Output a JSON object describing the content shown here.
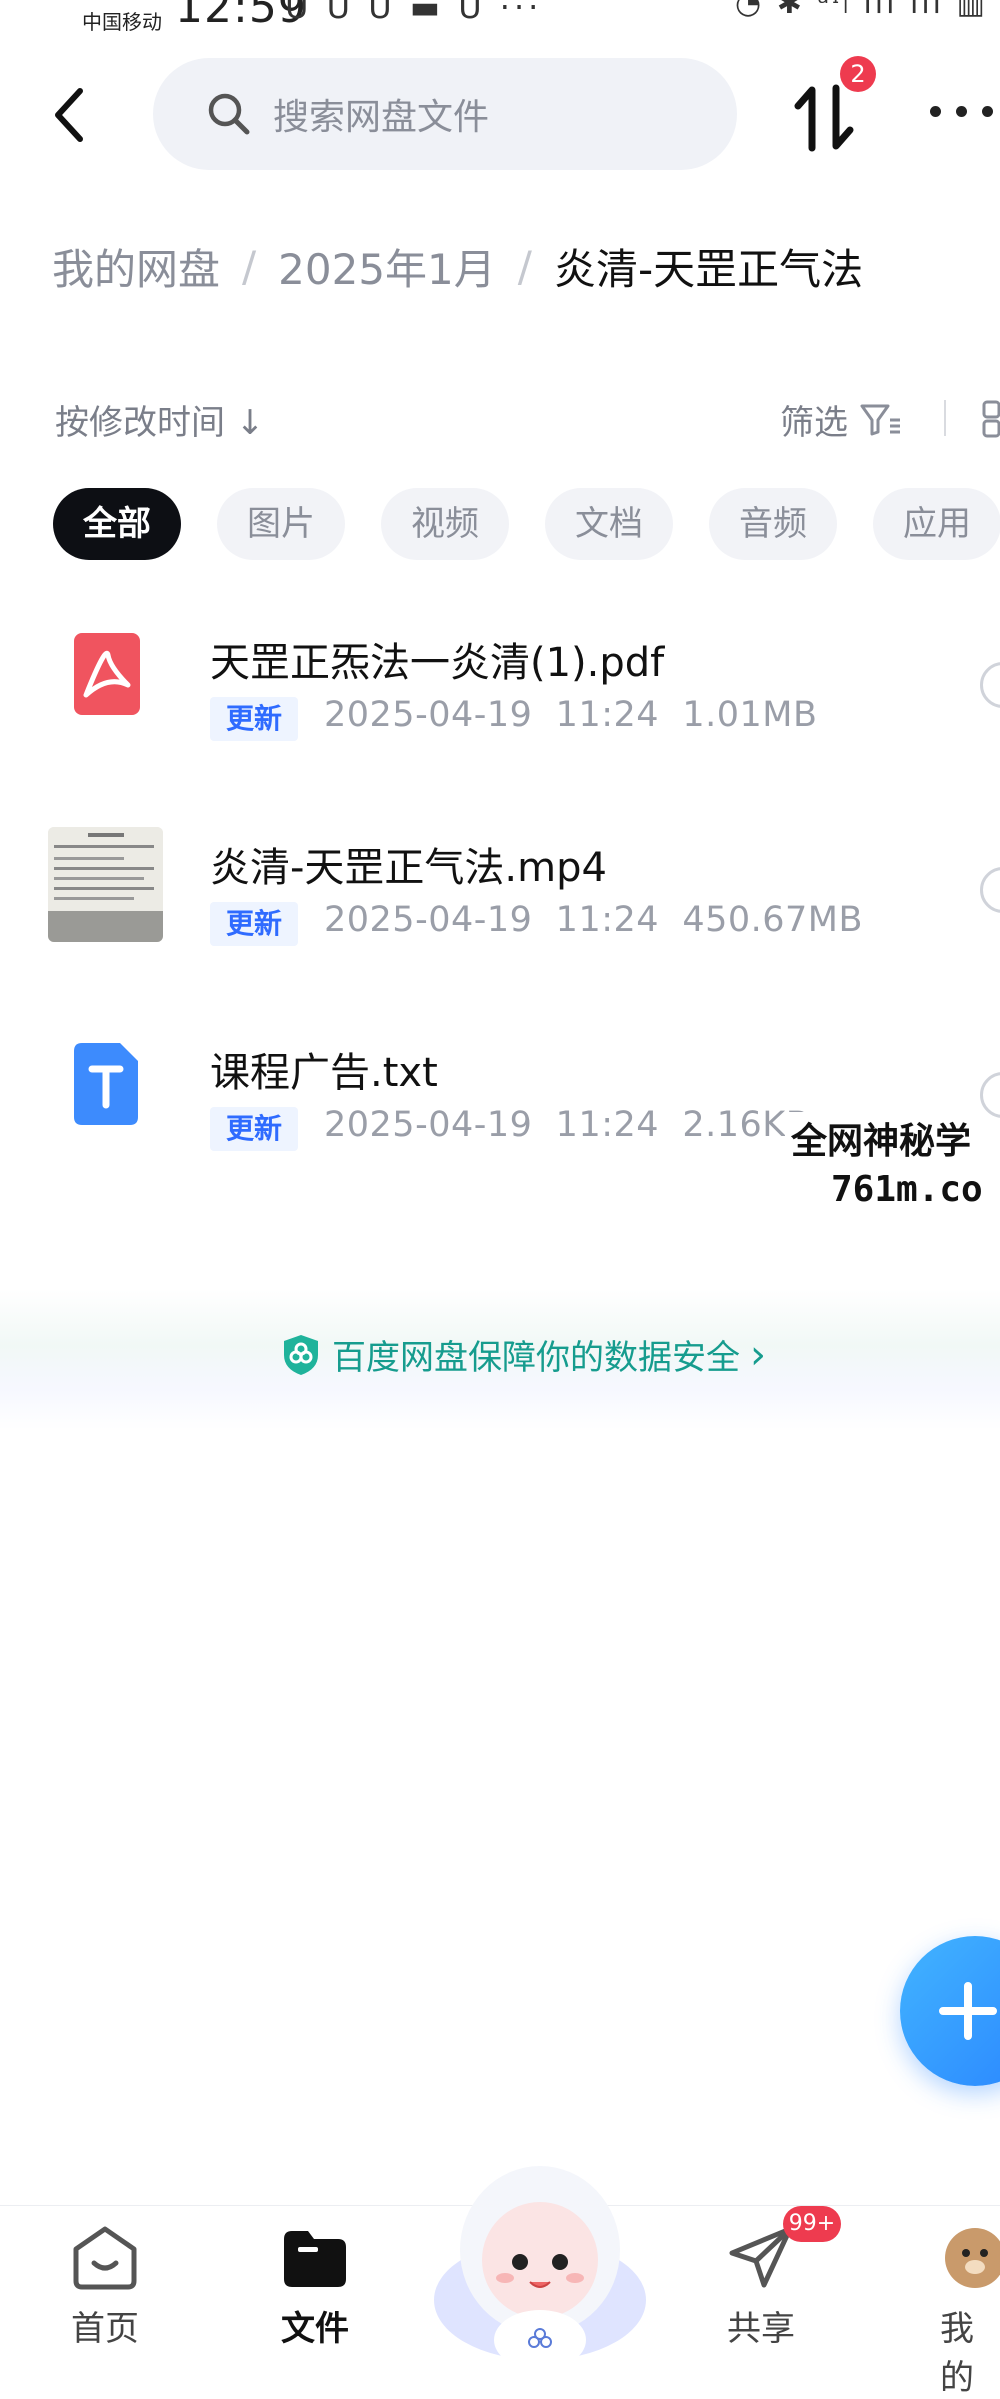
{
  "status_bar": {
    "carrier": "中国移动",
    "time": "12:59",
    "app_icons": "U U U ▬ U ···",
    "right_icons": "◔ ✱ ᵃᶦₗ ıll ıll ▥"
  },
  "header": {
    "search_placeholder": "搜索网盘文件",
    "transfer_badge": "2"
  },
  "breadcrumb": {
    "items": [
      "我的网盘",
      "2025年1月"
    ],
    "current": "炎清-天罡正气法",
    "separator": "/"
  },
  "toolbar": {
    "sort_label": "按修改时间",
    "sort_arrow": "↓",
    "filter_label": "筛选"
  },
  "chips": [
    {
      "label": "全部",
      "active": true
    },
    {
      "label": "图片",
      "active": false
    },
    {
      "label": "视频",
      "active": false
    },
    {
      "label": "文档",
      "active": false
    },
    {
      "label": "音频",
      "active": false
    },
    {
      "label": "应用",
      "active": false
    }
  ],
  "files": [
    {
      "name": "天罡正炁法一炎清(1).pdf",
      "tag": "更新",
      "date": "2025-04-19",
      "time": "11:24",
      "size": "1.01MB",
      "icon": "pdf-icon",
      "icon_color": "#f0545f"
    },
    {
      "name": "炎清-天罡正气法.mp4",
      "tag": "更新",
      "date": "2025-04-19",
      "time": "11:24",
      "size": "450.67MB",
      "icon": "video-thumbnail"
    },
    {
      "name": "课程广告.txt",
      "tag": "更新",
      "date": "2025-04-19",
      "time": "11:24",
      "size": "2.16KB",
      "icon": "txt-icon",
      "icon_color": "#3d8bfd"
    }
  ],
  "watermark": {
    "line1": "全网神秘学",
    "line2": "761m.co"
  },
  "safety_banner": {
    "text": "百度网盘保障你的数据安全",
    "chevron": "›"
  },
  "bottom_nav": {
    "items": [
      {
        "label": "首页",
        "active": false
      },
      {
        "label": "文件",
        "active": true
      },
      {
        "label": "共享",
        "active": false
      },
      {
        "label": "我的",
        "active": false
      }
    ],
    "share_badge": "99+"
  },
  "colors": {
    "accent": "#2f6bff",
    "badge_red": "#ee3b4f",
    "safety_green": "#169c8e"
  }
}
